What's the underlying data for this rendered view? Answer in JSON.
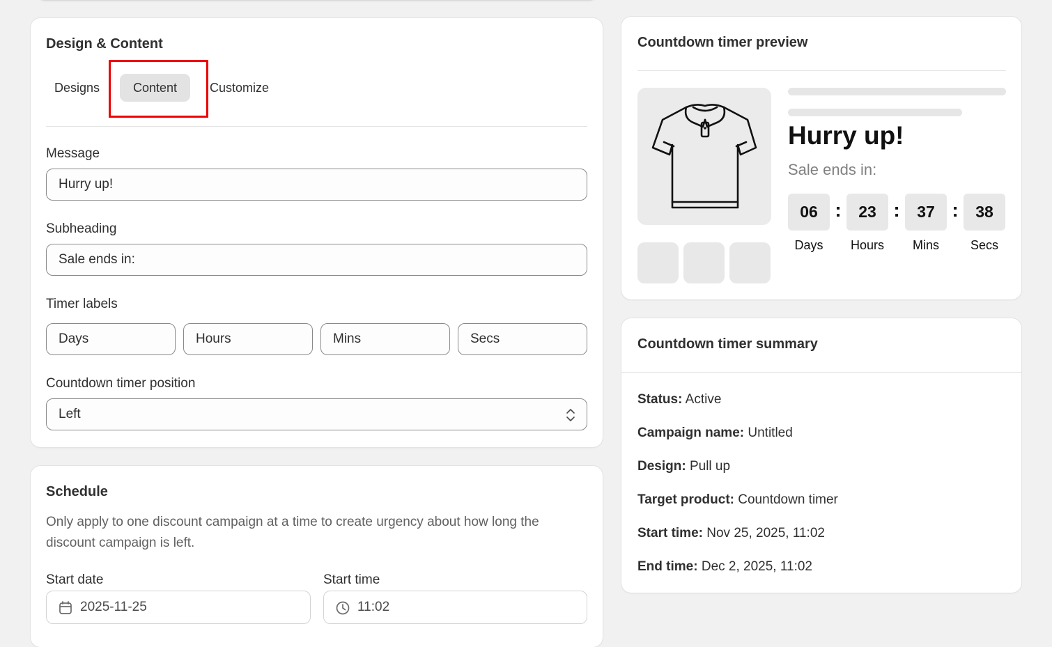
{
  "design_card": {
    "title": "Design & Content",
    "tabs": [
      "Designs",
      "Content",
      "Customize"
    ],
    "active_tab": "Content",
    "message": {
      "label": "Message",
      "value": "Hurry up!"
    },
    "subheading": {
      "label": "Subheading",
      "value": "Sale ends in:"
    },
    "timer_labels": {
      "label": "Timer labels",
      "values": [
        "Days",
        "Hours",
        "Mins",
        "Secs"
      ]
    },
    "position": {
      "label": "Countdown timer position",
      "value": "Left"
    }
  },
  "schedule_card": {
    "title": "Schedule",
    "description": "Only apply to one discount campaign at a time to create urgency about how long the discount campaign is left.",
    "start_date": {
      "label": "Start date",
      "value": "2025-11-25"
    },
    "start_time": {
      "label": "Start time",
      "value": "11:02"
    }
  },
  "preview_card": {
    "title": "Countdown timer preview",
    "message": "Hurry up!",
    "subheading": "Sale ends in:",
    "timer": [
      {
        "value": "06",
        "label": "Days"
      },
      {
        "value": "23",
        "label": "Hours"
      },
      {
        "value": "37",
        "label": "Mins"
      },
      {
        "value": "38",
        "label": "Secs"
      }
    ],
    "separator": ":",
    "product_icon": "polo-shirt-icon"
  },
  "summary_card": {
    "title": "Countdown timer summary",
    "rows": [
      {
        "key": "Status:",
        "value": "Active"
      },
      {
        "key": "Campaign name:",
        "value": "Untitled"
      },
      {
        "key": "Design:",
        "value": "Pull up"
      },
      {
        "key": "Target product:",
        "value": "Countdown timer"
      },
      {
        "key": "Start time:",
        "value": "Nov 25, 2025, 11:02"
      },
      {
        "key": "End time:",
        "value": "Dec 2, 2025, 11:02"
      }
    ]
  },
  "colors": {
    "highlight": "#ee0000",
    "active_tab_bg": "#e3e3e3"
  }
}
